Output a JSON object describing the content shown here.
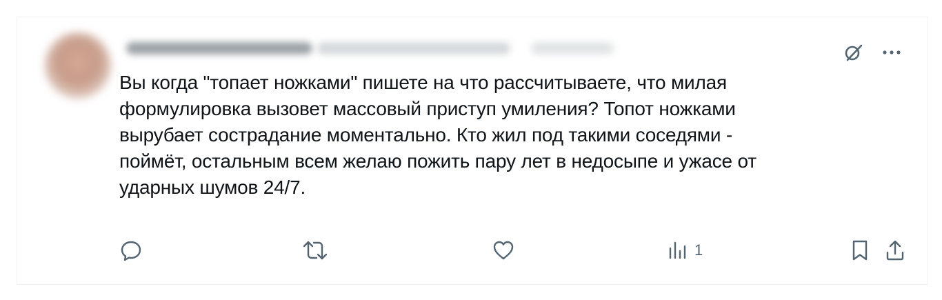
{
  "tweet": {
    "text": "Вы когда \"топает ножками\" пишете на что рассчитываете, что милая\nформулировка вызовет массовый приступ умиления? Топот ножками\nвырубает сострадание моментально. Кто жил под такими соседями -\nпоймёт, остальным всем желаю пожить пару лет в недосыпе и ужасе от\nударных шумов 24/7.",
    "views_count": "1"
  },
  "icons": {
    "grok": "grok-icon",
    "more": "more-icon",
    "reply": "reply-icon",
    "retweet": "retweet-icon",
    "like": "heart-icon",
    "views": "views-icon",
    "bookmark": "bookmark-icon",
    "share": "share-icon"
  },
  "colors": {
    "text": "#0f1419",
    "icon": "#536471",
    "border": "#eff3f4"
  }
}
